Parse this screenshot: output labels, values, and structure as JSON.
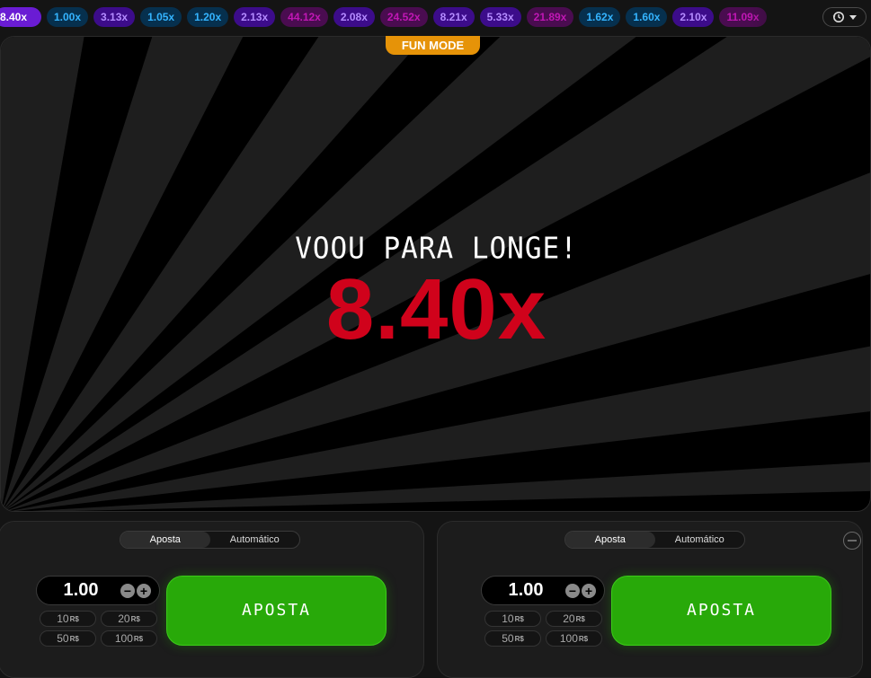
{
  "history": {
    "current": "8.40x",
    "items": [
      {
        "value": "1.00x",
        "tone": "blue"
      },
      {
        "value": "3.13x",
        "tone": "purple"
      },
      {
        "value": "1.05x",
        "tone": "blue"
      },
      {
        "value": "1.20x",
        "tone": "blue"
      },
      {
        "value": "2.13x",
        "tone": "purple"
      },
      {
        "value": "44.12x",
        "tone": "magenta"
      },
      {
        "value": "2.08x",
        "tone": "purple"
      },
      {
        "value": "24.52x",
        "tone": "magenta"
      },
      {
        "value": "8.21x",
        "tone": "purple"
      },
      {
        "value": "5.33x",
        "tone": "purple"
      },
      {
        "value": "21.89x",
        "tone": "magenta"
      },
      {
        "value": "1.62x",
        "tone": "blue"
      },
      {
        "value": "1.60x",
        "tone": "blue"
      },
      {
        "value": "2.10x",
        "tone": "purple"
      },
      {
        "value": "11.09x",
        "tone": "magenta"
      }
    ],
    "history_icon": "history-clock-icon",
    "dropdown_icon": "caret-down-icon"
  },
  "game": {
    "badge": "FUN MODE",
    "flew_text": "VOOU PARA LONGE!",
    "multiplier": "8.40x",
    "multiplier_color": "#d0021b"
  },
  "panels": [
    {
      "tabs": [
        "Aposta",
        "Automático"
      ],
      "active_tab": "Aposta",
      "amount": "1.00",
      "quick_bets": [
        {
          "amount": "10",
          "currency": "R$"
        },
        {
          "amount": "20",
          "currency": "R$"
        },
        {
          "amount": "50",
          "currency": "R$"
        },
        {
          "amount": "100",
          "currency": "R$"
        }
      ],
      "bet_label": "APOSTA"
    },
    {
      "tabs": [
        "Aposta",
        "Automático"
      ],
      "active_tab": "Aposta",
      "amount": "1.00",
      "quick_bets": [
        {
          "amount": "10",
          "currency": "R$"
        },
        {
          "amount": "20",
          "currency": "R$"
        },
        {
          "amount": "50",
          "currency": "R$"
        },
        {
          "amount": "100",
          "currency": "R$"
        }
      ],
      "bet_label": "APOSTA"
    }
  ],
  "colors": {
    "bet_button": "#28a909",
    "fun_mode": "#e69308"
  }
}
